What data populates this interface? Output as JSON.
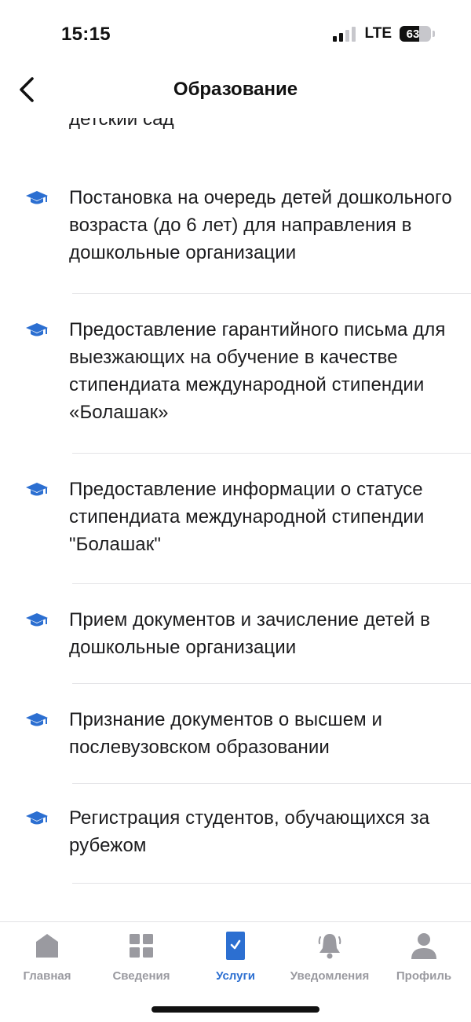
{
  "status": {
    "time": "15:15",
    "network": "LTE",
    "battery_percent": 63,
    "battery_label": "63",
    "signal_bars_active": 2,
    "signal_bars_total": 4
  },
  "nav": {
    "title": "Образование",
    "back_icon": "chevron-left-icon"
  },
  "list": {
    "icon": "graduation-cap-icon",
    "icon_color": "#2c6fd1",
    "partial_top_text": "детский сад",
    "items": [
      {
        "label": "Постановка на очередь детей дошкольного возраста (до 6 лет) для направления в дошкольные организации"
      },
      {
        "label": "Предоставление гарантийного письма для выезжающих на обучение в качестве стипендиата международной стипендии «Болашак»"
      },
      {
        "label": "Предоставление информации о статусе стипендиата международной стипендии \"Болашак\""
      },
      {
        "label": "Прием документов и зачисление детей в дошкольные организации"
      },
      {
        "label": "Признание документов о высшем и послевузовском образовании"
      },
      {
        "label": "Регистрация студентов, обучающихся за рубежом"
      }
    ]
  },
  "tabbar": {
    "active_color": "#2c6fd1",
    "inactive_color": "#9a9aa0",
    "tabs": [
      {
        "label": "Главная",
        "icon": "home-icon",
        "active": false
      },
      {
        "label": "Сведения",
        "icon": "grid-icon",
        "active": false
      },
      {
        "label": "Услуги",
        "icon": "services-check-icon",
        "active": true
      },
      {
        "label": "Уведомления",
        "icon": "bell-icon",
        "active": false
      },
      {
        "label": "Профиль",
        "icon": "profile-icon",
        "active": false
      }
    ]
  }
}
